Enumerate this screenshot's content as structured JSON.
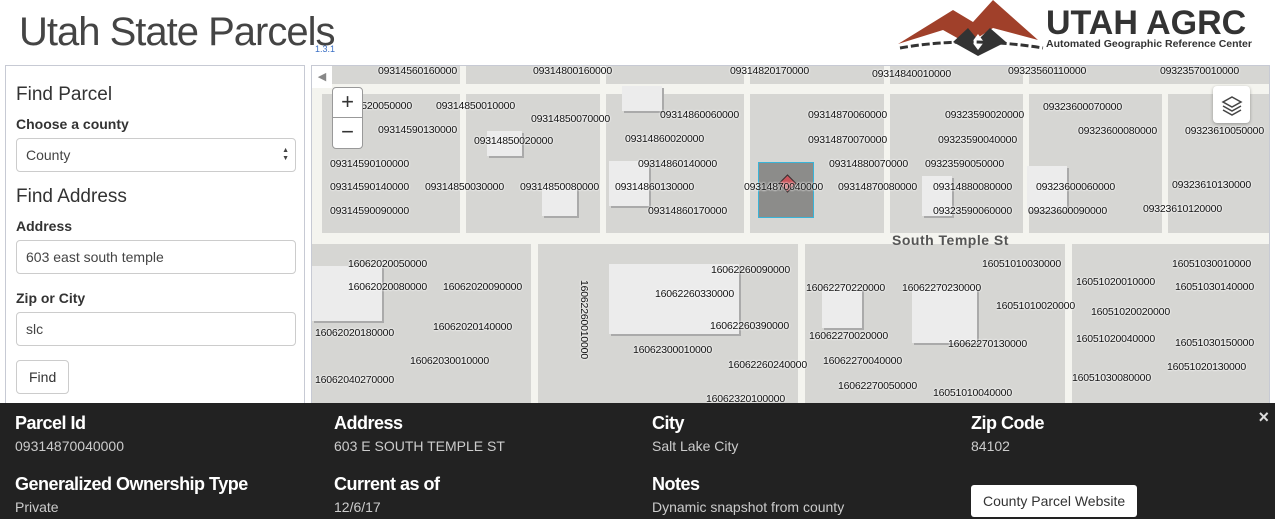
{
  "app": {
    "title": "Utah State Parcels",
    "version": "1.3.1"
  },
  "logo": {
    "name": "UTAH AGRC",
    "subtitle": "Automated Geographic Reference Center",
    "colors": {
      "mountain": "#a0402a",
      "dark": "#333333"
    }
  },
  "sidebar": {
    "find_parcel_heading": "Find Parcel",
    "county_label": "Choose a county",
    "county_value": "County",
    "find_address_heading": "Find Address",
    "address_label": "Address",
    "address_value": "603 east south temple",
    "zip_label": "Zip or City",
    "zip_value": "slc",
    "find_button": "Find"
  },
  "map": {
    "zoom_in": "+",
    "zoom_out": "−",
    "street": "South Temple St",
    "selected_parcel": "09314870040000",
    "parcels": [
      "09314560160000",
      "09314800160000",
      "09314820170000",
      "09314840010000",
      "09323560110000",
      "09323570010000",
      "09314520050000",
      "09314850010000",
      "09314860060000",
      "09314870060000",
      "09323590020000",
      "09323600070000",
      "09323610050000",
      "09314850070000",
      "09314590130000",
      "09314870070000",
      "09323590040000",
      "09323600080000",
      "09314850020000",
      "09314860020000",
      "09314590100000",
      "09314860140000",
      "09314880070000",
      "09323590050000",
      "09314590140000",
      "09314850030000",
      "09314850080000",
      "09314860130000",
      "09314870040000",
      "09314870080000",
      "09314880080000",
      "09323600060000",
      "09323610130000",
      "09314590090000",
      "09314860170000",
      "09323590060000",
      "09323600090000",
      "09323610120000",
      "16062020050000",
      "16062020080000",
      "16062020090000",
      "16062260090000",
      "16062260330000",
      "16062260010000",
      "16062020180000",
      "16062020140000",
      "16062260390000",
      "16062300010000",
      "16062030010000",
      "16062260240000",
      "16062040270000",
      "16062320100000",
      "16051010030000",
      "16062270220000",
      "16062270230000",
      "16051020010000",
      "16051030010000",
      "16051030140000",
      "16051010020000",
      "16051020020000",
      "16062270020000",
      "16062270130000",
      "16051020040000",
      "16051030150000",
      "16062270040000",
      "16051020130000",
      "16062270050000",
      "16051030080000",
      "16051010040000"
    ],
    "colors": {
      "selection": "#39b4d8",
      "pin": "#c9545b"
    }
  },
  "details": {
    "parcel_id": {
      "label": "Parcel Id",
      "value": "09314870040000"
    },
    "address": {
      "label": "Address",
      "value": "603 E SOUTH TEMPLE ST"
    },
    "city": {
      "label": "City",
      "value": "Salt Lake City"
    },
    "zip": {
      "label": "Zip Code",
      "value": "84102"
    },
    "ownership": {
      "label": "Generalized Ownership Type",
      "value": "Private"
    },
    "current": {
      "label": "Current as of",
      "value": "12/6/17"
    },
    "notes": {
      "label": "Notes",
      "value": "Dynamic snapshot from county"
    },
    "website_button": "County Parcel Website",
    "close": "×"
  }
}
